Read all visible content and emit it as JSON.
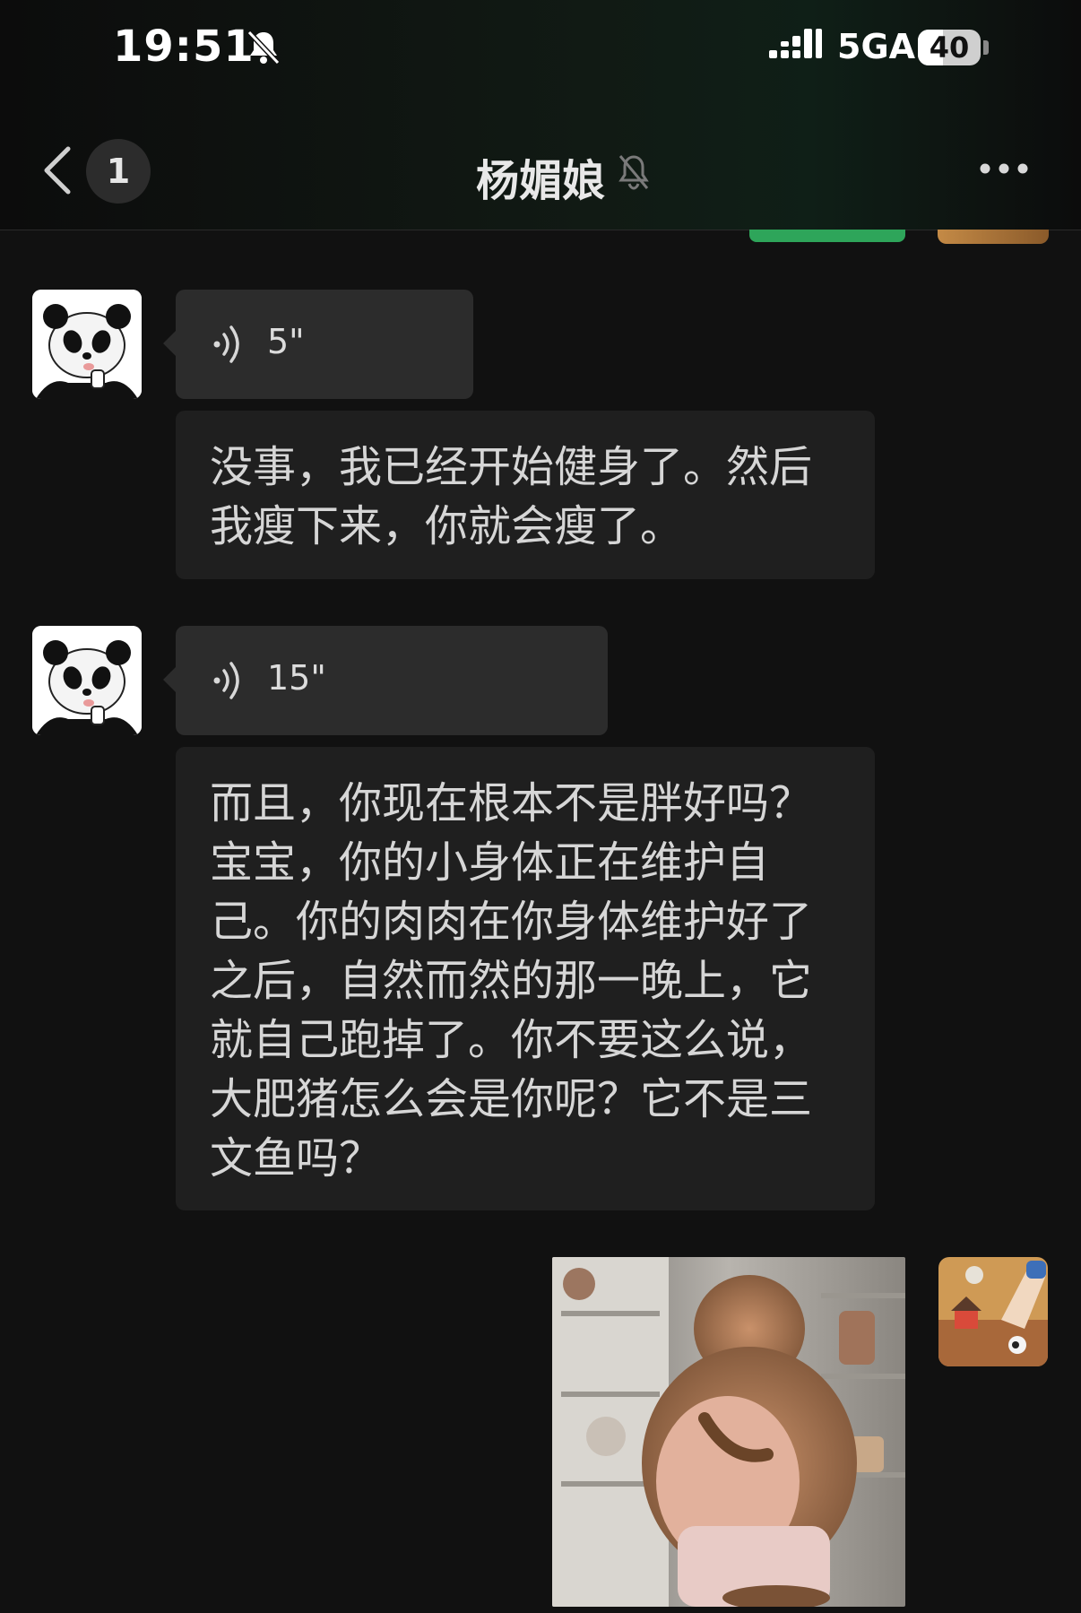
{
  "status_bar": {
    "time": "19:51",
    "network": "5GA",
    "battery": "40",
    "battery_level": 0.4
  },
  "header": {
    "unread_count": "1",
    "title": "杨媚娘",
    "icons": [
      "back-chevron-icon",
      "bell-off-icon",
      "more-icon"
    ]
  },
  "messages": [
    {
      "type": "voice",
      "sender": "contact",
      "duration": "5\""
    },
    {
      "type": "text",
      "sender": "contact",
      "text": "没事，我已经开始健身了。然后我瘦下来，你就会瘦了。"
    },
    {
      "type": "voice",
      "sender": "contact",
      "duration": "15\""
    },
    {
      "type": "text",
      "sender": "contact",
      "text": "而且，你现在根本不是胖好吗？宝宝，你的小身体正在维护自己。你的肉肉在你身体维护好了之后，自然而然的那一晚上，它就自己跑掉了。你不要这么说，大肥猪怎么会是你呢？它不是三文鱼吗？"
    },
    {
      "type": "sticker",
      "sender": "self",
      "description_icon": "fat-monkey-sticker"
    }
  ],
  "colors": {
    "background": "#111111",
    "bubble_incoming": "#2c2c2c",
    "text_bubble": "#1f1f1f",
    "accent_green": "#2ea55a"
  }
}
